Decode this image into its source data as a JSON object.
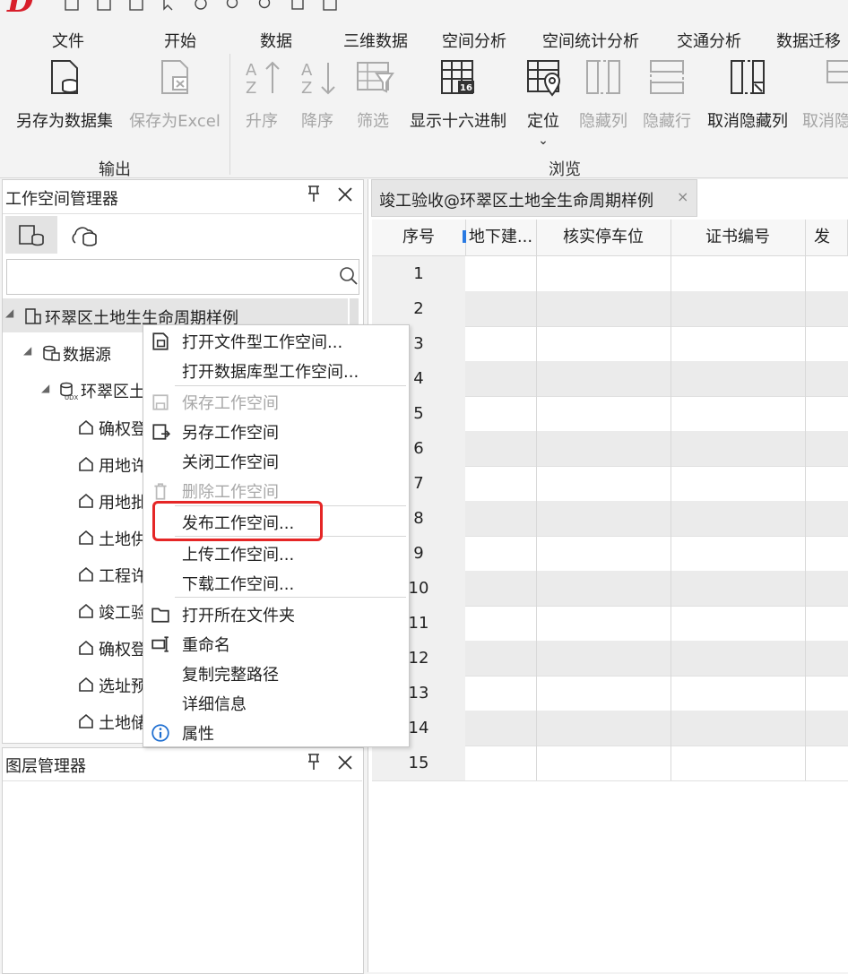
{
  "ribbon": {
    "tabs": [
      "文件",
      "开始",
      "数据",
      "三维数据",
      "空间分析",
      "空间统计分析",
      "交通分析",
      "数据迁移"
    ],
    "buttons": {
      "save_as_dataset": "另存为数据集",
      "save_as_excel": "保存为Excel",
      "ascending": "升序",
      "descending": "降序",
      "filter": "筛选",
      "show_hex": "显示十六进制",
      "locate": "定位",
      "hide_column": "隐藏列",
      "hide_row": "隐藏行",
      "unhide_column": "取消隐藏列",
      "unhide_row": "取消隐"
    },
    "groups": {
      "output": "输出",
      "browse": "浏览"
    }
  },
  "workspace_panel": {
    "title": "工作空间管理器",
    "search_placeholder": "",
    "tree": {
      "workspace": "环翠区土地生生命周期样例",
      "datasource_folder": "数据源",
      "datasource": "环翠区土",
      "datasets": [
        "确权登",
        "用地许",
        "用地批",
        "土地供",
        "工程许",
        "竣工验",
        "确权登",
        "选址预",
        "土地储"
      ]
    }
  },
  "layer_panel": {
    "title": "图层管理器"
  },
  "document": {
    "tab_title": "竣工验收@环翠区土地全生命周期样例",
    "columns": [
      "序号",
      "地下建...",
      "核实停车位",
      "证书编号",
      "发"
    ],
    "rows": [
      "1",
      "2",
      "3",
      "4",
      "5",
      "6",
      "7",
      "8",
      "9",
      "10",
      "11",
      "12",
      "13",
      "14",
      "15"
    ]
  },
  "context_menu": {
    "items": [
      {
        "label": "打开文件型工作空间...",
        "enabled": true
      },
      {
        "label": "打开数据库型工作空间...",
        "enabled": true
      },
      {
        "label": "保存工作空间",
        "enabled": false
      },
      {
        "label": "另存工作空间",
        "enabled": true
      },
      {
        "label": "关闭工作空间",
        "enabled": true
      },
      {
        "label": "删除工作空间",
        "enabled": false
      },
      {
        "label": "发布工作空间...",
        "enabled": true,
        "highlighted": true
      },
      {
        "label": "上传工作空间...",
        "enabled": true
      },
      {
        "label": "下载工作空间...",
        "enabled": true
      },
      {
        "label": "打开所在文件夹",
        "enabled": true
      },
      {
        "label": "重命名",
        "enabled": true
      },
      {
        "label": "复制完整路径",
        "enabled": true
      },
      {
        "label": "详细信息",
        "enabled": true
      },
      {
        "label": "属性",
        "enabled": true
      }
    ]
  },
  "colors": {
    "accent_red": "#e52626",
    "logo_red": "#d81e2a",
    "disabled_gray": "#a5a5a5"
  }
}
